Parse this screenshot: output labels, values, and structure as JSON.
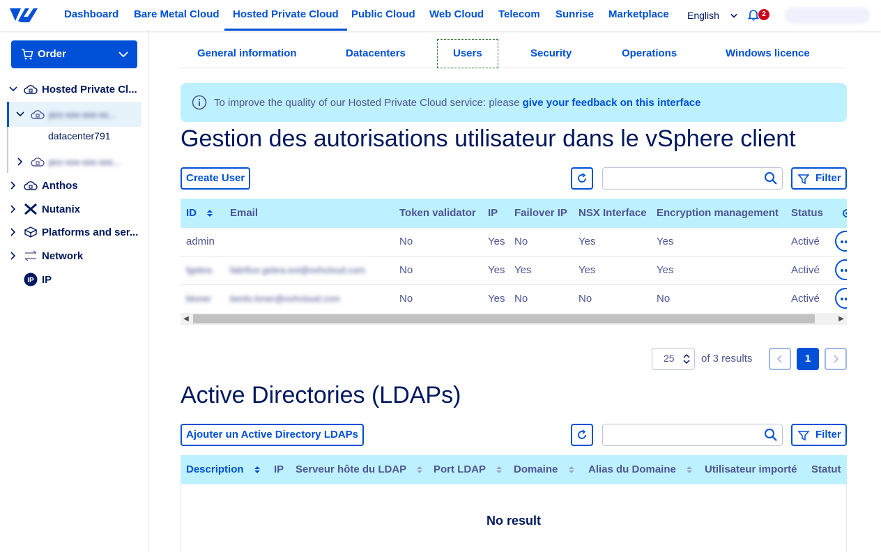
{
  "topnav": {
    "items": [
      {
        "label": "Dashboard"
      },
      {
        "label": "Bare Metal Cloud"
      },
      {
        "label": "Hosted Private Cloud"
      },
      {
        "label": "Public Cloud"
      },
      {
        "label": "Web Cloud"
      },
      {
        "label": "Telecom"
      },
      {
        "label": "Sunrise"
      },
      {
        "label": "Marketplace"
      }
    ],
    "active": "Hosted Private Cloud",
    "language": "English",
    "notification_count": "2"
  },
  "sidebar": {
    "order_label": "Order",
    "items": [
      {
        "label": "Hosted Private Cl...",
        "icon": "cloud-lock-icon"
      },
      {
        "label": "datacenter791"
      },
      {
        "label": "Anthos",
        "icon": "cloud-lock-icon"
      },
      {
        "label": "Nutanix",
        "icon": "nutanix-icon"
      },
      {
        "label": "Platforms and ser...",
        "icon": "box-icon"
      },
      {
        "label": "Network",
        "icon": "network-arrows-icon"
      },
      {
        "label": "IP",
        "icon": "ip-icon"
      }
    ]
  },
  "tabs": [
    {
      "label": "General information"
    },
    {
      "label": "Datacenters"
    },
    {
      "label": "Users"
    },
    {
      "label": "Security"
    },
    {
      "label": "Operations"
    },
    {
      "label": "Windows licence"
    }
  ],
  "banner": {
    "text": "To improve the quality of our Hosted Private Cloud service: please",
    "link": "give your feedback on this interface"
  },
  "users_section": {
    "title": "Gestion des autorisations utilisateur dans le vSphere client",
    "create_label": "Create User",
    "filter_label": "Filter",
    "columns": [
      "ID",
      "Email",
      "Token validator",
      "IP",
      "Failover IP",
      "NSX Interface",
      "Encryption management",
      "Status"
    ],
    "rows": [
      {
        "id": "admin",
        "email": "",
        "token": "No",
        "ip": "Yes",
        "failover": "No",
        "nsx": "Yes",
        "encryption": "Yes",
        "status": "Activé"
      },
      {
        "id": "",
        "email": "",
        "token": "No",
        "ip": "Yes",
        "failover": "Yes",
        "nsx": "Yes",
        "encryption": "Yes",
        "status": "Activé"
      },
      {
        "id": "",
        "email": "",
        "token": "No",
        "ip": "Yes",
        "failover": "No",
        "nsx": "No",
        "encryption": "No",
        "status": "Activé"
      }
    ],
    "pagination": {
      "per_page": "25",
      "results": "of 3 results",
      "page": "1"
    }
  },
  "ldap_section": {
    "title": "Active Directories (LDAPs)",
    "add_label": "Ajouter un Active Directory LDAPs",
    "filter_label": "Filter",
    "columns": [
      "Description",
      "IP",
      "Serveur hôte du LDAP",
      "Port LDAP",
      "Domaine",
      "Alias du Domaine",
      "Utilisateur importé",
      "Statut"
    ],
    "empty": "No result"
  },
  "colors": {
    "primary": "#0050d7",
    "header_bg": "#bef1ff",
    "text_dark": "#00185e",
    "text": "#4d5592",
    "badge": "#d0021b"
  }
}
